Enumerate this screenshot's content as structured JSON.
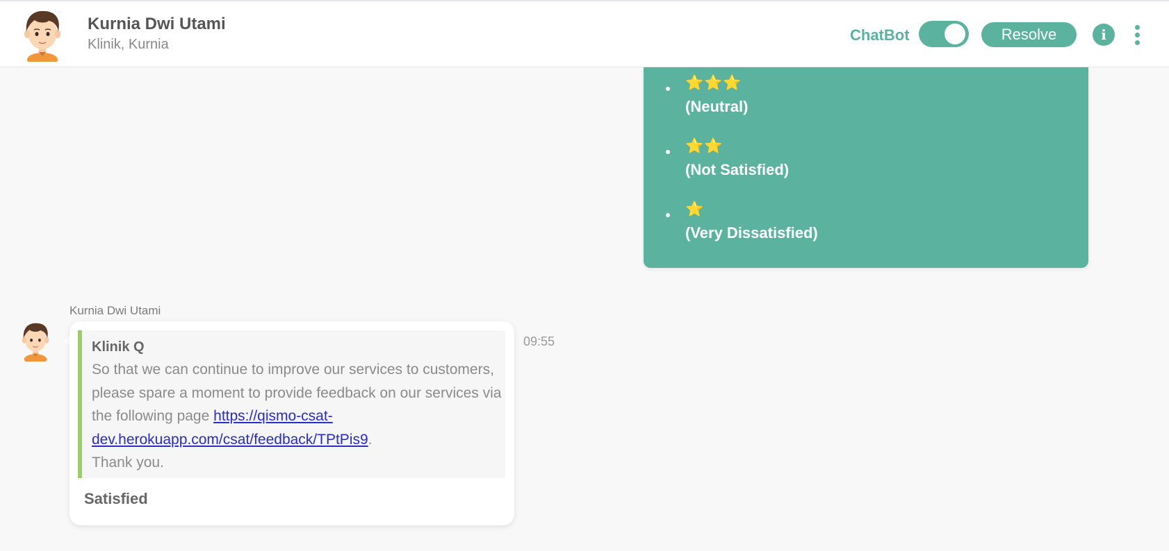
{
  "header": {
    "contact_name": "Kurnia Dwi Utami",
    "contact_subtitle": "Klinik, Kurnia",
    "chatbot_label": "ChatBot",
    "chatbot_enabled": true,
    "resolve_label": "Resolve",
    "info_icon": "info-icon",
    "more_icon": "more-vertical-icon"
  },
  "outgoing_message": {
    "rating_options": [
      {
        "stars": "⭐⭐⭐",
        "label": "(Neutral)",
        "star_count": 3
      },
      {
        "stars": "⭐⭐",
        "label": "(Not Satisfied)",
        "star_count": 2
      },
      {
        "stars": "⭐",
        "label": "(Very Dissatisfied)",
        "star_count": 1
      }
    ],
    "bubble_color": "#5ab29f"
  },
  "incoming_message": {
    "sender": "Kurnia Dwi Utami",
    "time": "09:55",
    "quoted": {
      "title": "Klinik Q",
      "body_text": "So that we can continue to improve our services to customers, please spare a moment to provide feedback on our services via the following page ",
      "link_text": "https://qismo-csat-dev.herokuapp.com/csat/feedback/TPtPis9",
      "after_link": ".",
      "closing": "Thank you."
    },
    "reply": "Satisfied"
  },
  "colors": {
    "accent": "#5ab29f",
    "quote_border": "#9ccc6b",
    "link": "#2b2bc9"
  }
}
